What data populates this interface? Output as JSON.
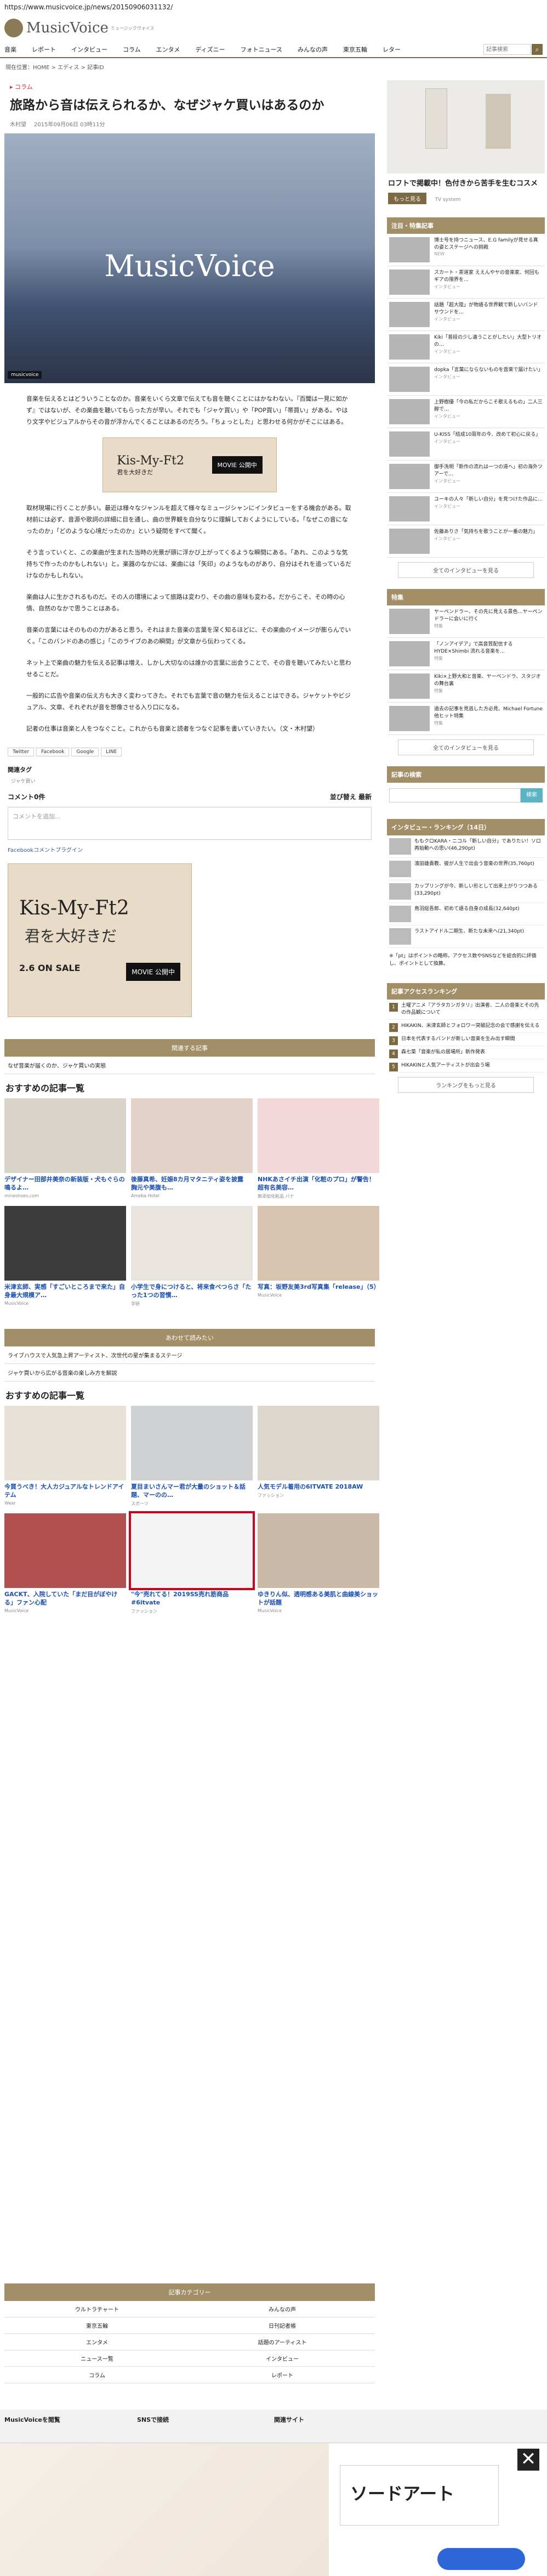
{
  "browser": {
    "url": "https://www.musicvoice.jp/news/20150906031132/"
  },
  "header": {
    "logo_text": "MusicVoice",
    "logo_sub": "ミュージックヴォイス",
    "nav": [
      "音楽",
      "レポート",
      "インタビュー",
      "コラム",
      "エンタメ",
      "ディズニー",
      "フォトニュース",
      "みんなの声",
      "東京五輪",
      "レター"
    ],
    "search_placeholder": "記事検索"
  },
  "breadcrumb": "現在位置：HOME > エディス > 記事ID",
  "article": {
    "category": "コラム",
    "title": "旅路から音は伝えられるか、なぜジャケ買いはあるのか",
    "author": "木村望",
    "date": "2015年09月06日 03時11分",
    "hero_logo": "MusicVoice",
    "hero_credit": "musicvoice",
    "paragraphs": [
      "音楽を伝えるとはどういうことなのか。音楽をいくら文章で伝えても音を聴くことにはかなわない。『百聞は一見に如かず』ではないが、その楽曲を聴いてもらった方が早い。それでも「ジャケ買い」や「POP買い」「帯買い」がある。やはり文字やビジュアルからその音が浮かんでくることはあるのだろう。「ちょっとした」と思わせる何かがそこにはある。",
      "取材現場に行くことが多い。最近は様々なジャンルを超えて様々なミュージシャンにインタビューをする機会がある。取材前には必ず、音源や歌詞の詳細に目を通し、曲の世界観を自分なりに理解しておくようにしている。「なぜこの音になったのか」「どのような心境だったのか」という疑問をすべて聞く。",
      "そう言っていくと、この楽曲が生まれた当時の光景が頭に浮かび上がってくるような瞬間にある。「あれ、このような気持ちで作ったのかもしれない」と。楽器のなかには、楽曲には「矢印」のようなものがあり、自分はそれを追っているだけなのかもしれない。",
      "楽曲は人に生かされるものだ。その人の環境によって旅路は変わり、その曲の意味も変わる。だからこそ、その時の心情、自然のなかで思うことはある。",
      "音楽の言葉にはそのものの力があると思う。それはまた音楽の言葉を深く知るほどに、その楽曲のイメージが膨らんでいく。「このバンドのあの感じ」「このライブのあの瞬間」が文章から伝わってくる。",
      "ネット上で楽曲の魅力を伝える記事は増え、しかし大切なのは誰かの言葉に出会うことで、その音を聴いてみたいと思わせることだ。",
      "一般的に広告や音楽の伝え方も大きく変わってきた。それでも言葉で音の魅力を伝えることはできる。ジャケットやビジュアル、文章、それぞれが音を想像させる入り口になる。",
      "記者の仕事は音楽と人をつなぐこと。これからも音楽と読者をつなぐ記事を書いていきたい。（文・木村望）"
    ],
    "inline_ad": {
      "title": "Kis-My-Ft2",
      "sub": "君を大好きだ",
      "movie": "MOVIE 公開中"
    },
    "share": [
      "Twitter",
      "Facebook",
      "Google",
      "LINE"
    ],
    "tags_title": "関連タグ",
    "tag": "ジャケ買い",
    "comments_title": "コメント0件",
    "comments_sort": "並び替え 最新",
    "comment_placeholder": "コメントを追加...",
    "fb_plugin": "Facebookコメントプラグイン"
  },
  "big_ad": {
    "t1": "Kis-My-Ft2",
    "t2": "君を大好きだ",
    "t3": "2.6 ON SALE",
    "t4": "MOVIE 公開中"
  },
  "related": {
    "head": "関連する記事",
    "line": "なぜ音楽が届くのか、ジャケ買いの実態",
    "osusume": "おすすめの記事一覧",
    "cards": [
      {
        "cap": "デザイナー田部井美奈の新装版・犬もぐらの鳴るよ…",
        "src": "mineshoes.com"
      },
      {
        "cap": "後藤真希、妊娠8カ月マタニティ姿を披露　胸元や美腹も…",
        "src": "Ameba Hotel"
      },
      {
        "cap": "NHKあさイチ出演「化粧のプロ」が警告！超有名美容…",
        "src": "無添加化粧品 バナ"
      },
      {
        "cap": "米津玄師、実感「すごいところまで来た」自身最大規模ア…",
        "src": "MusicVoice"
      },
      {
        "cap": "小学生で身につけると、将来食べつらさ「たった1つの習慣…",
        "src": "学研"
      },
      {
        "cap": "写真：坂野友美3rd写真集「release」（5）",
        "src": "MusicVoice"
      }
    ]
  },
  "popular": {
    "head": "あわせて読みたい",
    "lines": [
      "ライブハウスで人気急上昇アーティスト、次世代の星が集まるステージ",
      "ジャケ買いから広がる音楽の楽しみ方を解説"
    ],
    "osusume": "おすすめの記事一覧",
    "cards": [
      {
        "cap": "今買うべき！大人カジュアルなトレンドアイテム",
        "src": "Wear"
      },
      {
        "cap": "夏目まいさんマー君が大量のショット＆話題、マーのの…",
        "src": "スポーツ"
      },
      {
        "cap": "人気モデル着用の6ITVATE 2018AW",
        "src": "ファッション"
      },
      {
        "cap": "GACKT、入院していた「まだ目がぼやける」ファン心配",
        "src": "MusicVoice"
      },
      {
        "cap": "\"今\"売れてる！2019SS売れ筋商品 #6itvate",
        "src": "ファッション"
      },
      {
        "cap": "ゆきりん似、透明感ある美肌と曲線美ショットが話題",
        "src": "MusicVoice"
      }
    ]
  },
  "footer_cat": {
    "head": "記事カテゴリー",
    "items": [
      "ウルトラチャート",
      "みんなの声",
      "東京五輪",
      "日刊記者帳",
      "エンタメ",
      "話題のアーティスト",
      "ニュース一覧",
      "インタビュー",
      "コラム",
      "レポート"
    ]
  },
  "footer": {
    "col1": "MusicVoiceを閲覧",
    "col2": "SNSで接続",
    "col3": "関連サイト"
  },
  "sidebar": {
    "ad_title": "ロフトで掲載中！色付きから苦手を生むコスメ",
    "ad_btn": "もっと見る",
    "ad_brand": "TV system",
    "news_head": "注目・特集記事",
    "news": [
      {
        "txt": "博士号を持つニュース、E.G familyが見せる真の姿とステージへの挑戦",
        "time": "NEW"
      },
      {
        "txt": "スカート・茶道家 ええんやヤの音楽家、何回もギアの限界を…",
        "time": "インタビュー"
      },
      {
        "txt": "話題「超大陸」が物語る世界観で新しいバンドサウンドを…",
        "time": "インタビュー"
      },
      {
        "txt": "Kiki「普段の少し違うことがしたい」大型トリオの…",
        "time": "インタビュー"
      },
      {
        "txt": "dopka「言葉にならないものを音楽で届けたい」",
        "time": "インタビュー"
      },
      {
        "txt": "上野樹優「今の私だからこそ歌えるもの」二人三脚で…",
        "time": "インタビュー"
      },
      {
        "txt": "U-KISS「結成10周年の今、改めて初心に戻る」",
        "time": "インタビュー"
      },
      {
        "txt": "御手洗明「新作の流れは一つの道へ」初の海外ツアーで…",
        "time": "インタビュー"
      },
      {
        "txt": "ユーキの人々「新しい自分」を見つけた作品に…",
        "time": "インタビュー"
      },
      {
        "txt": "佐藤ありさ「気持ちを歌うことが一番の魅力」",
        "time": "インタビュー"
      }
    ],
    "more1": "全てのインタビューを見る",
    "special_head": "特集",
    "special": [
      {
        "txt": "ヤーペンドラー、その先に見える景色…ヤーペンドラーに会いに行く",
        "time": "特集"
      },
      {
        "txt": "「ノンアイデア」で高音質配信するHYDE×Shimbi 流れる音楽を…",
        "time": "特集"
      },
      {
        "txt": "Kiki×上野大和と音楽、ヤーペンドラ、スタジオの舞台裏",
        "time": "特集"
      },
      {
        "txt": "過去の記事を見逃した方必見、Michael Fortune 他ヒット特集",
        "time": "特集"
      }
    ],
    "more2": "全てのインタビューを見る",
    "search_head": "記事の検索",
    "search_btn": "検索",
    "rank_head": "インタビュー・ランキング（14日）",
    "rank": [
      "ももクロKARA・ニコル「新しい自分」でありたい！ソロ再始動への思い(46,290pt)",
      "濱田雄貴教、彼が人生で出会う音楽の世界(35,760pt)",
      "カップリングが今、新しい形として出来上がりつつある(33,290pt)",
      "鳥羽総吾郎、初めて語る自身の成長(32,640pt)",
      "ラストアイドル二期生、新たな未来へ(21,340pt)"
    ],
    "rank_text": "※「pt」はポイントの略称。アクセス数やSNSなどを総合的に評価し、ポイントとして換算。",
    "feature_head": "記事アクセスランキング",
    "features": [
      "土曜アニメ『アラタカンガタリ』出演者、二人の音楽とその先の作品観について",
      "HIKAKIN、米津玄師とフォロワー突破記念の会で感謝を伝える",
      "日本を代表するバンドが新しい音楽を生み出す瞬間",
      "森七菜「音楽が私の居場所」新作発表",
      "HIKAKINと人気アーティストが出会う場"
    ],
    "more3": "ランキングをもっと見る"
  },
  "bottom_ad": {
    "text": "ソードアート"
  }
}
